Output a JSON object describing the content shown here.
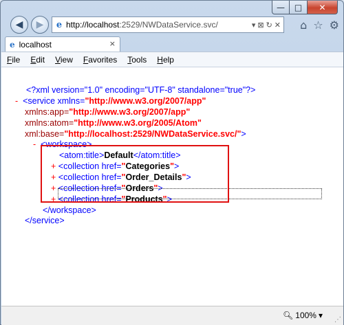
{
  "window": {
    "caption_minimize": "—",
    "caption_maximize": "□",
    "caption_close": "✕"
  },
  "nav": {
    "back_icon": "back-arrow-icon",
    "back_glyph": "◀",
    "forward_glyph": "▶",
    "address_host": "http://localhost",
    "address_rest": ":2529/NWDataService.svc/",
    "address_tools": [
      "▾",
      "⊠",
      "↻",
      "✕"
    ],
    "home_glyph": "⌂",
    "favorites_glyph": "☆",
    "settings_glyph": "⚙"
  },
  "tab": {
    "label": "localhost",
    "close": "×"
  },
  "menu": {
    "items": [
      {
        "key": "F",
        "rest": "ile"
      },
      {
        "key": "E",
        "rest": "dit"
      },
      {
        "key": "V",
        "rest": "iew"
      },
      {
        "key": "F",
        "rest": "avorites",
        "pre": ""
      },
      {
        "key": "T",
        "rest": "ools"
      },
      {
        "key": "H",
        "rest": "elp"
      }
    ]
  },
  "xml": {
    "decl": "<?xml version=\"1.0\" encoding=\"UTF-8\" standalone=\"true\"?>",
    "service_open": "<service xmlns=",
    "service_xmlns": "\"http://www.w3.org/2007/app\"",
    "xmlns_app_attr": "xmlns:app=",
    "xmlns_app_val": "\"http://www.w3.org/2007/app\"",
    "xmlns_atom_attr": "xmlns:atom=",
    "xmlns_atom_val": "\"http://www.w3.org/2005/Atom\"",
    "xml_base_attr": "xml:base=",
    "xml_base_val": "\"http://localhost:2529/NWDataService.svc/\"",
    "close_bracket": ">",
    "workspace_open": "<workspace>",
    "atom_title_open": "<atom:title>",
    "atom_title_text": "Default",
    "atom_title_close": "</atom:title>",
    "collection_open": "<collection href=",
    "collections": [
      "Categories",
      "Order_Details",
      "Orders",
      "Products"
    ],
    "workspace_close": "</workspace>",
    "service_close": "</service>",
    "minus": "-",
    "plus": "+"
  },
  "status": {
    "zoom": "100%",
    "zoom_arrow": "▾"
  }
}
